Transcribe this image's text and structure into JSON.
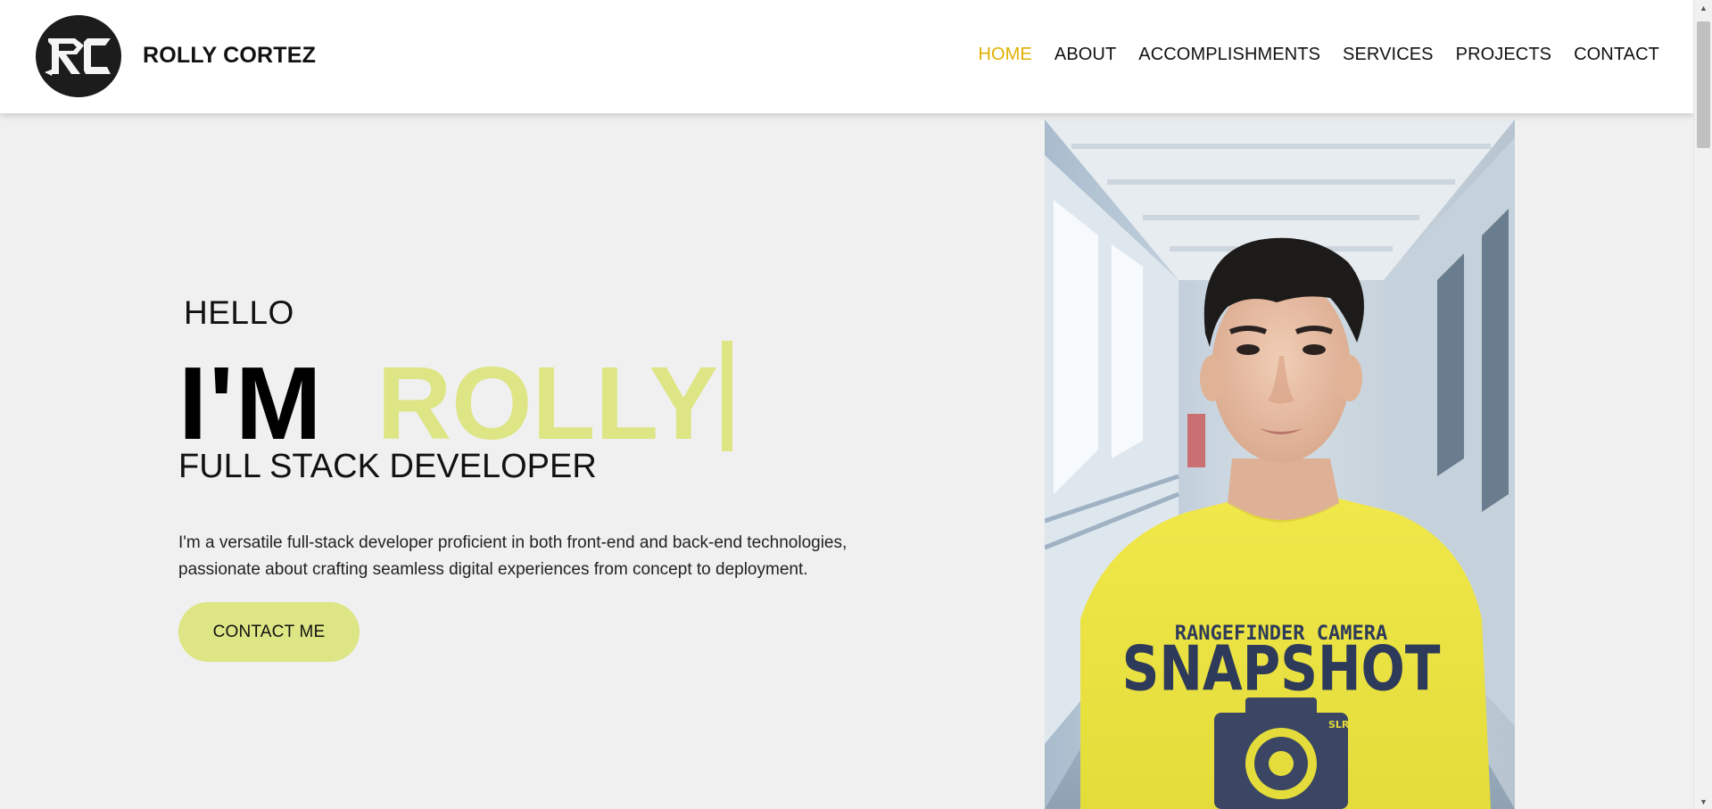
{
  "header": {
    "brand": "ROLLY CORTEZ",
    "logo_text": "RC",
    "nav": [
      {
        "label": "HOME",
        "active": true
      },
      {
        "label": "ABOUT",
        "active": false
      },
      {
        "label": "ACCOMPLISHMENTS",
        "active": false
      },
      {
        "label": "SERVICES",
        "active": false
      },
      {
        "label": "PROJECTS",
        "active": false
      },
      {
        "label": "CONTACT",
        "active": false
      }
    ]
  },
  "hero": {
    "greeting": "HELLO",
    "intro": "I'M",
    "name": "ROLLY",
    "role": "FULL STACK DEVELOPER",
    "description": "I'm a versatile full-stack developer proficient in both front-end and back-end technologies, passionate about crafting seamless digital experiences from concept to deployment.",
    "cta_label": "CONTACT ME"
  },
  "portrait": {
    "shirt_text_top": "RANGEFINDER CAMERA",
    "shirt_text_main": "SNAPSHOT",
    "shirt_text_camera": "SLR"
  },
  "colors": {
    "accent_active": "#e0b000",
    "accent_light": "#dde584",
    "background": "#f0f0f0",
    "header_bg": "#ffffff",
    "logo_bg": "#1c1c1c"
  },
  "icons": {
    "scroll_up": "scroll-up-arrow-icon",
    "scroll_down": "scroll-down-arrow-icon"
  }
}
